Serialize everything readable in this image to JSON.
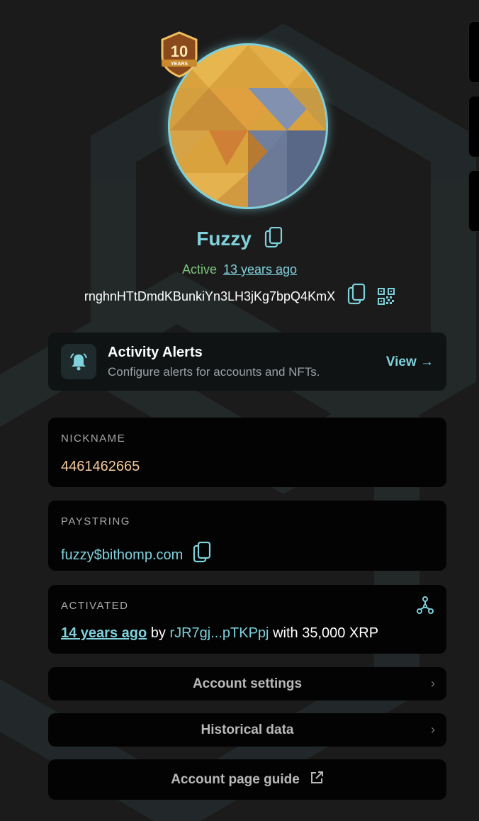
{
  "colors": {
    "background": "#1b1b1b",
    "accent": "#7fd1dc",
    "active_green": "#7cc47c",
    "nickname_orange": "#f3c899",
    "card": "#030303"
  },
  "profile": {
    "badge_icon": "ten-years-badge-icon",
    "badge_text": "10 YEARS",
    "name": "Fuzzy",
    "active_label": "Active",
    "active_since": "13 years ago",
    "address": "rnghnHTtDmdKBunkiYn3LH3jKg7bpQ4KmX"
  },
  "alerts": {
    "icon": "bell-icon",
    "title": "Activity Alerts",
    "subtitle": "Configure alerts for accounts and NFTs.",
    "view_label": "View →"
  },
  "nickname": {
    "label": "NICKNAME",
    "value": "4461462665"
  },
  "paystring": {
    "label": "PAYSTRING",
    "value": "fuzzy$bithomp.com"
  },
  "activated": {
    "label": "ACTIVATED",
    "ago": "14 years ago",
    "by_text": "by",
    "by_address": "rJR7gj...pTKPpj",
    "with_text": "with 35,000 XRP"
  },
  "buttons": {
    "account_settings": "Account settings",
    "historical_data": "Historical data",
    "account_page_guide": "Account page guide",
    "chevron": "›"
  }
}
